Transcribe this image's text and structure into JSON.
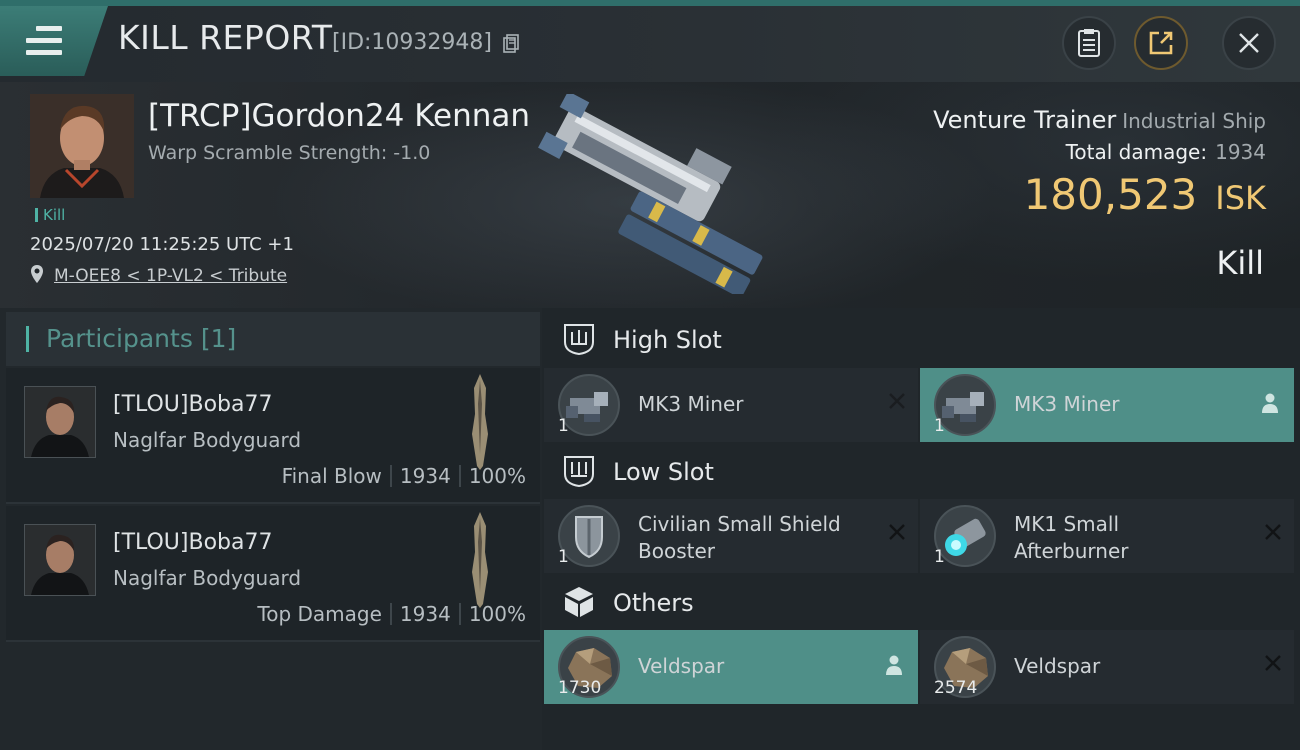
{
  "header": {
    "title": "KILL REPORT",
    "report_id": "[ID:10932948]",
    "icons": [
      "menu-icon",
      "copy-icon",
      "clipboard-icon",
      "share-icon",
      "close-icon"
    ]
  },
  "victim": {
    "pilot_name": "[TRCP]Gordon24 Kennan",
    "warp_scramble": "Warp Scramble Strength: -1.0",
    "tag": "Kill",
    "datetime": "2025/07/20 11:25:25 UTC +1",
    "location": "M-OEE8 < 1P-VL2 < Tribute",
    "ship_name": "Venture Trainer",
    "ship_class": "Industrial Ship",
    "total_damage_label": "Total damage:",
    "total_damage": "1934",
    "isk_value": "180,523",
    "isk_unit": "ISK",
    "result": "Kill"
  },
  "participants": {
    "title": "Participants",
    "count": "[1]",
    "rows": [
      {
        "name": "[TLOU]Boba77",
        "ship": "Naglfar Bodyguard",
        "role": "Final Blow",
        "damage": "1934",
        "percent": "100%"
      },
      {
        "name": "[TLOU]Boba77",
        "ship": "Naglfar Bodyguard",
        "role": "Top Damage",
        "damage": "1934",
        "percent": "100%"
      }
    ]
  },
  "fitting": {
    "high_slot": {
      "label": "High Slot",
      "items": [
        {
          "name": "MK3 Miner",
          "qty": "1",
          "status": "destroyed",
          "icon": "miner-icon"
        },
        {
          "name": "MK3 Miner",
          "qty": "1",
          "status": "dropped",
          "icon": "miner-icon"
        }
      ]
    },
    "low_slot": {
      "label": "Low Slot",
      "items": [
        {
          "name_line1": "Civilian Small Shield",
          "name_line2": "Booster",
          "qty": "1",
          "status": "destroyed",
          "icon": "shield-booster-icon"
        },
        {
          "name_line1": "MK1 Small",
          "name_line2": "Afterburner",
          "qty": "1",
          "status": "destroyed",
          "icon": "afterburner-icon"
        }
      ]
    },
    "others": {
      "label": "Others",
      "items": [
        {
          "name": "Veldspar",
          "qty": "1730",
          "status": "dropped",
          "icon": "ore-icon"
        },
        {
          "name": "Veldspar",
          "qty": "2574",
          "status": "destroyed",
          "icon": "ore-icon"
        }
      ]
    }
  },
  "colors": {
    "accent_teal": "#4f8f88",
    "isk_gold": "#f0c874",
    "participants_title": "#55928c"
  }
}
